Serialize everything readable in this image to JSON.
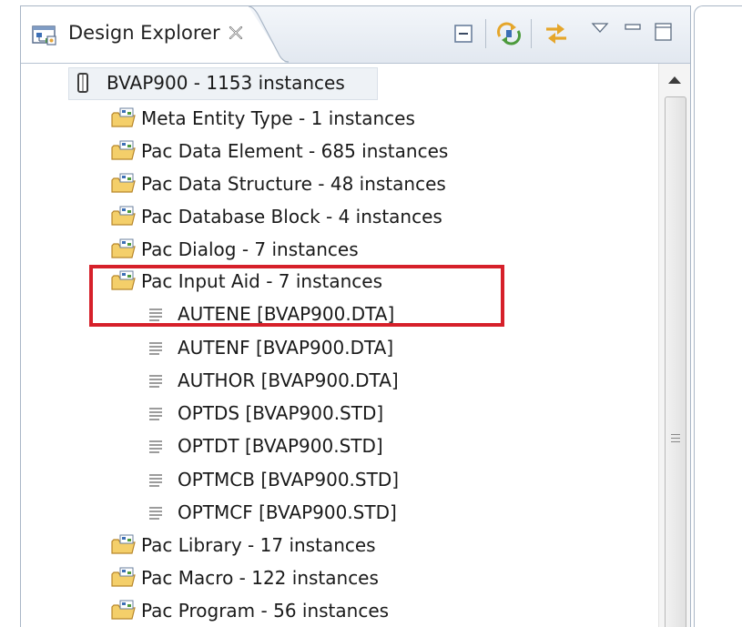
{
  "view": {
    "title": "Design Explorer",
    "toolbar_icons": [
      "collapse-all-icon",
      "sync-icon",
      "link-with-editor-icon",
      "view-menu-icon",
      "minimize-icon",
      "maximize-icon"
    ]
  },
  "tree": {
    "root": "BVAP900 - 1153 instances",
    "groups_before": [
      "Meta Entity Type - 1 instances",
      "Pac Data Element - 685 instances",
      "Pac Data Structure - 48 instances",
      "Pac Database Block - 4 instances",
      "Pac Dialog - 7 instances"
    ],
    "expanded_group": "Pac Input Aid - 7 instances",
    "children": [
      "AUTENE  [BVAP900.DTA]",
      "AUTENF  [BVAP900.DTA]",
      "AUTHOR  [BVAP900.DTA]",
      "OPTDS  [BVAP900.STD]",
      "OPTDT  [BVAP900.STD]",
      "OPTMCB  [BVAP900.STD]",
      "OPTMCF  [BVAP900.STD]"
    ],
    "groups_after": [
      "Pac Library - 17 instances",
      "Pac Macro - 122 instances",
      "Pac Program - 56 instances"
    ]
  },
  "colors": {
    "highlight": "#d6202a",
    "folder": "#e8b84a",
    "accent": "#3d6fb5"
  }
}
